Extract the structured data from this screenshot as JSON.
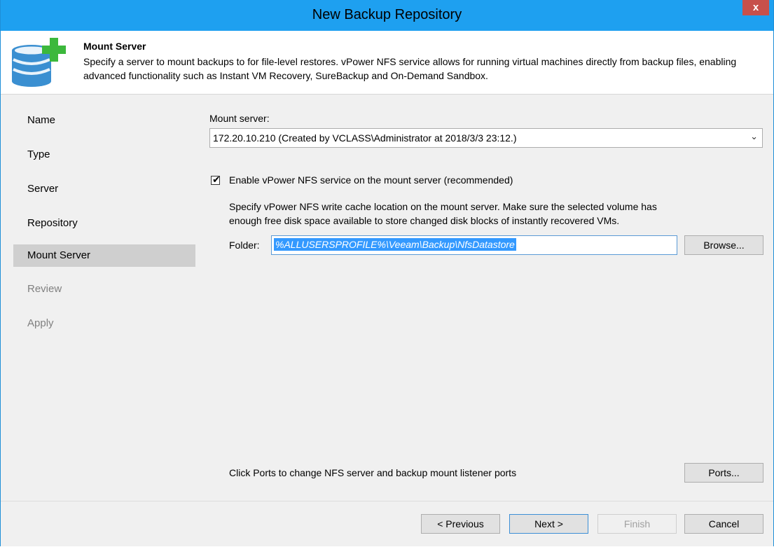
{
  "window": {
    "title": "New Backup Repository",
    "close_label": "x"
  },
  "header": {
    "title": "Mount Server",
    "description": "Specify a server to mount backups to for file-level restores. vPower NFS service allows for running virtual machines directly from backup files, enabling advanced functionality such as Instant VM Recovery, SureBackup and On-Demand Sandbox.",
    "icon": "database-add-icon"
  },
  "sidebar": {
    "items": [
      {
        "label": "Name",
        "state": "normal"
      },
      {
        "label": "Type",
        "state": "normal"
      },
      {
        "label": "Server",
        "state": "normal"
      },
      {
        "label": "Repository",
        "state": "normal"
      },
      {
        "label": "Mount Server",
        "state": "active"
      },
      {
        "label": "Review",
        "state": "disabled"
      },
      {
        "label": "Apply",
        "state": "disabled"
      }
    ]
  },
  "main": {
    "mount_server_label": "Mount server:",
    "mount_server_value": "172.20.10.210 (Created by VCLASS\\Administrator at 2018/3/3 23:12.)",
    "nfs_checkbox_label": "Enable vPower NFS service on the mount server (recommended)",
    "nfs_checked": true,
    "cache_description_line1": "Specify vPower NFS write cache location on the mount server. Make sure the selected volume has",
    "cache_description_line2": "enough free disk space available to store changed disk blocks of instantly recovered VMs.",
    "folder_label": "Folder:",
    "folder_value": "%ALLUSERSPROFILE%\\Veeam\\Backup\\NfsDatastore",
    "browse_label": "Browse...",
    "ports_text": "Click Ports to change NFS server and backup mount listener ports",
    "ports_label": "Ports..."
  },
  "footer": {
    "previous_label": "< Previous",
    "next_label": "Next >",
    "finish_label": "Finish",
    "cancel_label": "Cancel"
  },
  "colors": {
    "titlebar": "#1ea0f0",
    "close": "#c7504b",
    "selection": "#3399ff",
    "icon_green": "#3cb83c",
    "icon_blue": "#3a8fd1"
  }
}
